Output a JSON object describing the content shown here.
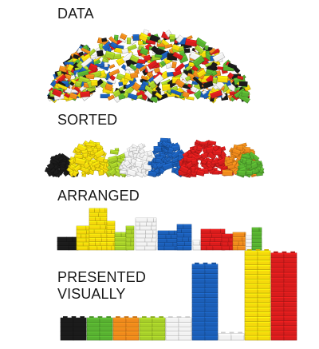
{
  "stages": [
    {
      "id": "data",
      "label": "DATA"
    },
    {
      "id": "sorted",
      "label": "SORTED"
    },
    {
      "id": "arranged",
      "label": "ARRANGED"
    },
    {
      "id": "presented",
      "label": "PRESENTED\nVISUALLY"
    }
  ],
  "palette": {
    "black": "#1b1b1b",
    "yellow": "#f5d90c",
    "green": "#58b131",
    "lime": "#a7cf2a",
    "white": "#f2f2f2",
    "blue": "#1c5fb8",
    "red": "#d81d1d",
    "orange": "#f08a1c"
  },
  "piles": {
    "data_colors": [
      "red",
      "yellow",
      "blue",
      "green",
      "white",
      "orange",
      "black",
      "lime"
    ],
    "sorted_colors": [
      "black",
      "yellow",
      "lime",
      "white",
      "blue",
      "red",
      "orange"
    ],
    "arranged_colors": [
      "black",
      "yellow",
      "lime",
      "white",
      "blue",
      "red",
      "orange",
      "green"
    ]
  },
  "presented_bars": [
    {
      "color": "black",
      "level": 1.0
    },
    {
      "color": "green",
      "level": 1.0
    },
    {
      "color": "orange",
      "level": 1.0
    },
    {
      "color": "lime",
      "level": 1.0
    },
    {
      "color": "white",
      "level": 1.0
    },
    {
      "color": "blue",
      "level": 3.4
    },
    {
      "color": "white",
      "level": 0.3
    },
    {
      "color": "yellow",
      "level": 4.0
    },
    {
      "color": "red",
      "level": 3.9
    }
  ]
}
